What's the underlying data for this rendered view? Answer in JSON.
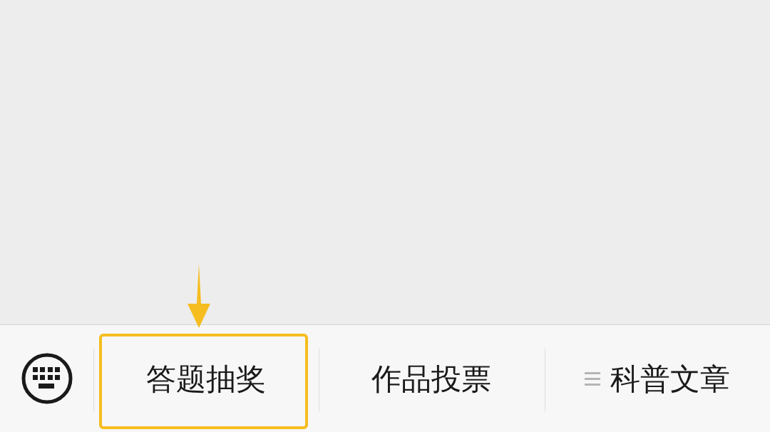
{
  "menu_bar": {
    "items": [
      {
        "label": "答题抽奖",
        "has_submenu": false,
        "highlighted": true
      },
      {
        "label": "作品投票",
        "has_submenu": false,
        "highlighted": false
      },
      {
        "label": "科普文章",
        "has_submenu": true,
        "highlighted": false
      }
    ]
  }
}
